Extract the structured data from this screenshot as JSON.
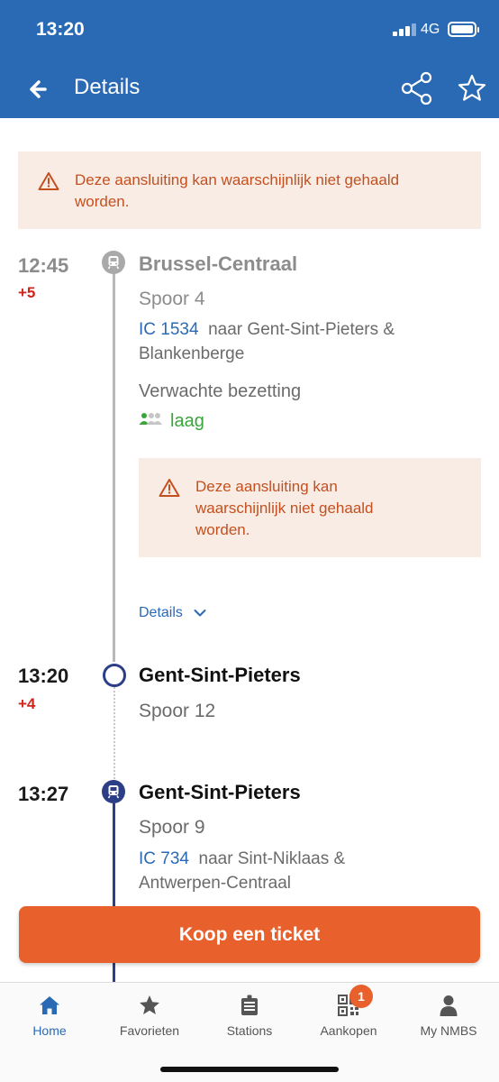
{
  "status_bar": {
    "time": "13:20",
    "network": "4G"
  },
  "header": {
    "title": "Details"
  },
  "top_alert": {
    "text_line1": "Deze aansluiting kan waarschijnlijk niet gehaald",
    "text_line2": "worden."
  },
  "stops": [
    {
      "time": "12:45",
      "delay": "+5",
      "station": "Brussel-Centraal",
      "platform": "Spoor 4",
      "train_code": "IC  1534",
      "train_dest_line1": "naar Gent-Sint-Pieters &",
      "train_dest_line2": "Blankenberge",
      "occupancy_label": "Verwachte bezetting",
      "occupancy_value": "laag",
      "alert_line1": "Deze aansluiting kan",
      "alert_line2": "waarschijnlijk niet gehaald",
      "alert_line3": "worden.",
      "details_link": "Details"
    },
    {
      "time": "13:20",
      "delay": "+4",
      "station": "Gent-Sint-Pieters",
      "platform": "Spoor 12"
    },
    {
      "time": "13:27",
      "station": "Gent-Sint-Pieters",
      "platform": "Spoor 9",
      "train_code": "IC  734",
      "train_dest_line1": "naar Sint-Niklaas &",
      "train_dest_line2": "Antwerpen-Centraal"
    }
  ],
  "cta": {
    "label": "Koop een ticket"
  },
  "tabbar": {
    "items": [
      {
        "label": "Home",
        "icon": "home-icon"
      },
      {
        "label": "Favorieten",
        "icon": "star-icon"
      },
      {
        "label": "Stations",
        "icon": "station-board-icon"
      },
      {
        "label": "Aankopen",
        "icon": "qr-code-icon"
      },
      {
        "label": "My NMBS",
        "icon": "person-icon"
      }
    ],
    "badge": "1"
  },
  "colors": {
    "header": "#2a6ab5",
    "accent": "#e8602c",
    "alert_bg": "#f8ece5",
    "alert_text": "#c4501f",
    "delay": "#d1241c",
    "occupancy_low": "#38a638",
    "line_active": "#2c3e86"
  }
}
